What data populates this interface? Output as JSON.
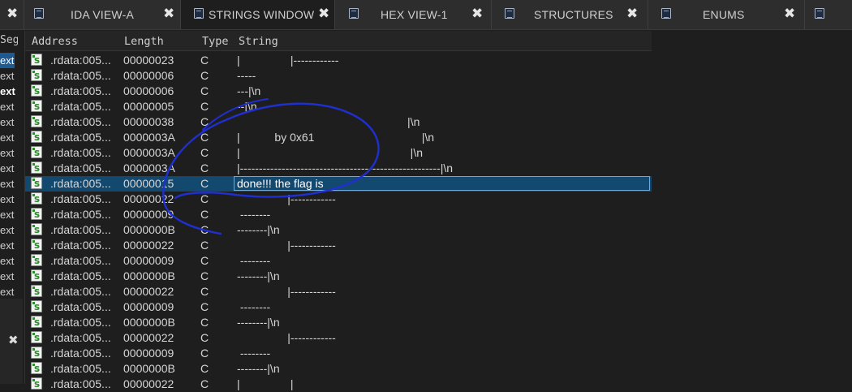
{
  "tabs": [
    {
      "label": "IDA VIEW-A",
      "icon": "ida-view-icon"
    },
    {
      "label": "STRINGS WINDOW",
      "icon": "strings-icon"
    },
    {
      "label": "HEX VIEW-1",
      "icon": "hex-view-icon"
    },
    {
      "label": "STRUCTURES",
      "icon": "structures-icon"
    },
    {
      "label": "ENUMS",
      "icon": "enums-icon"
    }
  ],
  "close_glyph": "✖",
  "segments": {
    "header": "Segr",
    "rows": [
      "ext",
      "ext",
      "ext",
      "ext",
      "ext",
      "ext",
      "ext",
      "ext",
      "ext",
      "ext",
      "ext",
      "ext",
      "ext",
      "ext",
      "ext",
      "ext"
    ]
  },
  "table": {
    "columns": {
      "address": "Address",
      "length": "Length",
      "type": "Type",
      "string": "String"
    },
    "rows": [
      {
        "address": ".rdata:005...",
        "length": "00000023",
        "type": "C",
        "string": "|                |------------"
      },
      {
        "address": ".rdata:005...",
        "length": "00000006",
        "type": "C",
        "string": "-----"
      },
      {
        "address": ".rdata:005...",
        "length": "00000006",
        "type": "C",
        "string": "---|\\n"
      },
      {
        "address": ".rdata:005...",
        "length": "00000005",
        "type": "C",
        "string": "--|\\n"
      },
      {
        "address": ".rdata:005...",
        "length": "00000038",
        "type": "C",
        "string": "                                                      |\\n"
      },
      {
        "address": ".rdata:005...",
        "length": "0000003A",
        "type": "C",
        "string": "|           by 0x61                                  |\\n"
      },
      {
        "address": ".rdata:005...",
        "length": "0000003A",
        "type": "C",
        "string": "|                                                      |\\n"
      },
      {
        "address": ".rdata:005...",
        "length": "0000003A",
        "type": "C",
        "string": "|-----------------------------------------------------|\\n"
      },
      {
        "address": ".rdata:005...",
        "length": "00000015",
        "type": "C",
        "string": "done!!! the flag is"
      },
      {
        "address": ".rdata:005...",
        "length": "00000022",
        "type": "C",
        "string": "                |------------"
      },
      {
        "address": ".rdata:005...",
        "length": "00000009",
        "type": "C",
        "string": " --------"
      },
      {
        "address": ".rdata:005...",
        "length": "0000000B",
        "type": "C",
        "string": "--------|\\n"
      },
      {
        "address": ".rdata:005...",
        "length": "00000022",
        "type": "C",
        "string": "                |------------"
      },
      {
        "address": ".rdata:005...",
        "length": "00000009",
        "type": "C",
        "string": " --------"
      },
      {
        "address": ".rdata:005...",
        "length": "0000000B",
        "type": "C",
        "string": "--------|\\n"
      },
      {
        "address": ".rdata:005...",
        "length": "00000022",
        "type": "C",
        "string": "                |------------"
      },
      {
        "address": ".rdata:005...",
        "length": "00000009",
        "type": "C",
        "string": " --------"
      },
      {
        "address": ".rdata:005...",
        "length": "0000000B",
        "type": "C",
        "string": "--------|\\n"
      },
      {
        "address": ".rdata:005...",
        "length": "00000022",
        "type": "C",
        "string": "                |------------"
      },
      {
        "address": ".rdata:005...",
        "length": "00000009",
        "type": "C",
        "string": " --------"
      },
      {
        "address": ".rdata:005...",
        "length": "0000000B",
        "type": "C",
        "string": "--------|\\n"
      },
      {
        "address": ".rdata:005...",
        "length": "00000022",
        "type": "C",
        "string": "|                |"
      }
    ],
    "selected_index": 8
  },
  "colors": {
    "selection": "#14496f",
    "selection_border": "#6fa9d8",
    "annotation_ink": "#1f2fd0"
  }
}
